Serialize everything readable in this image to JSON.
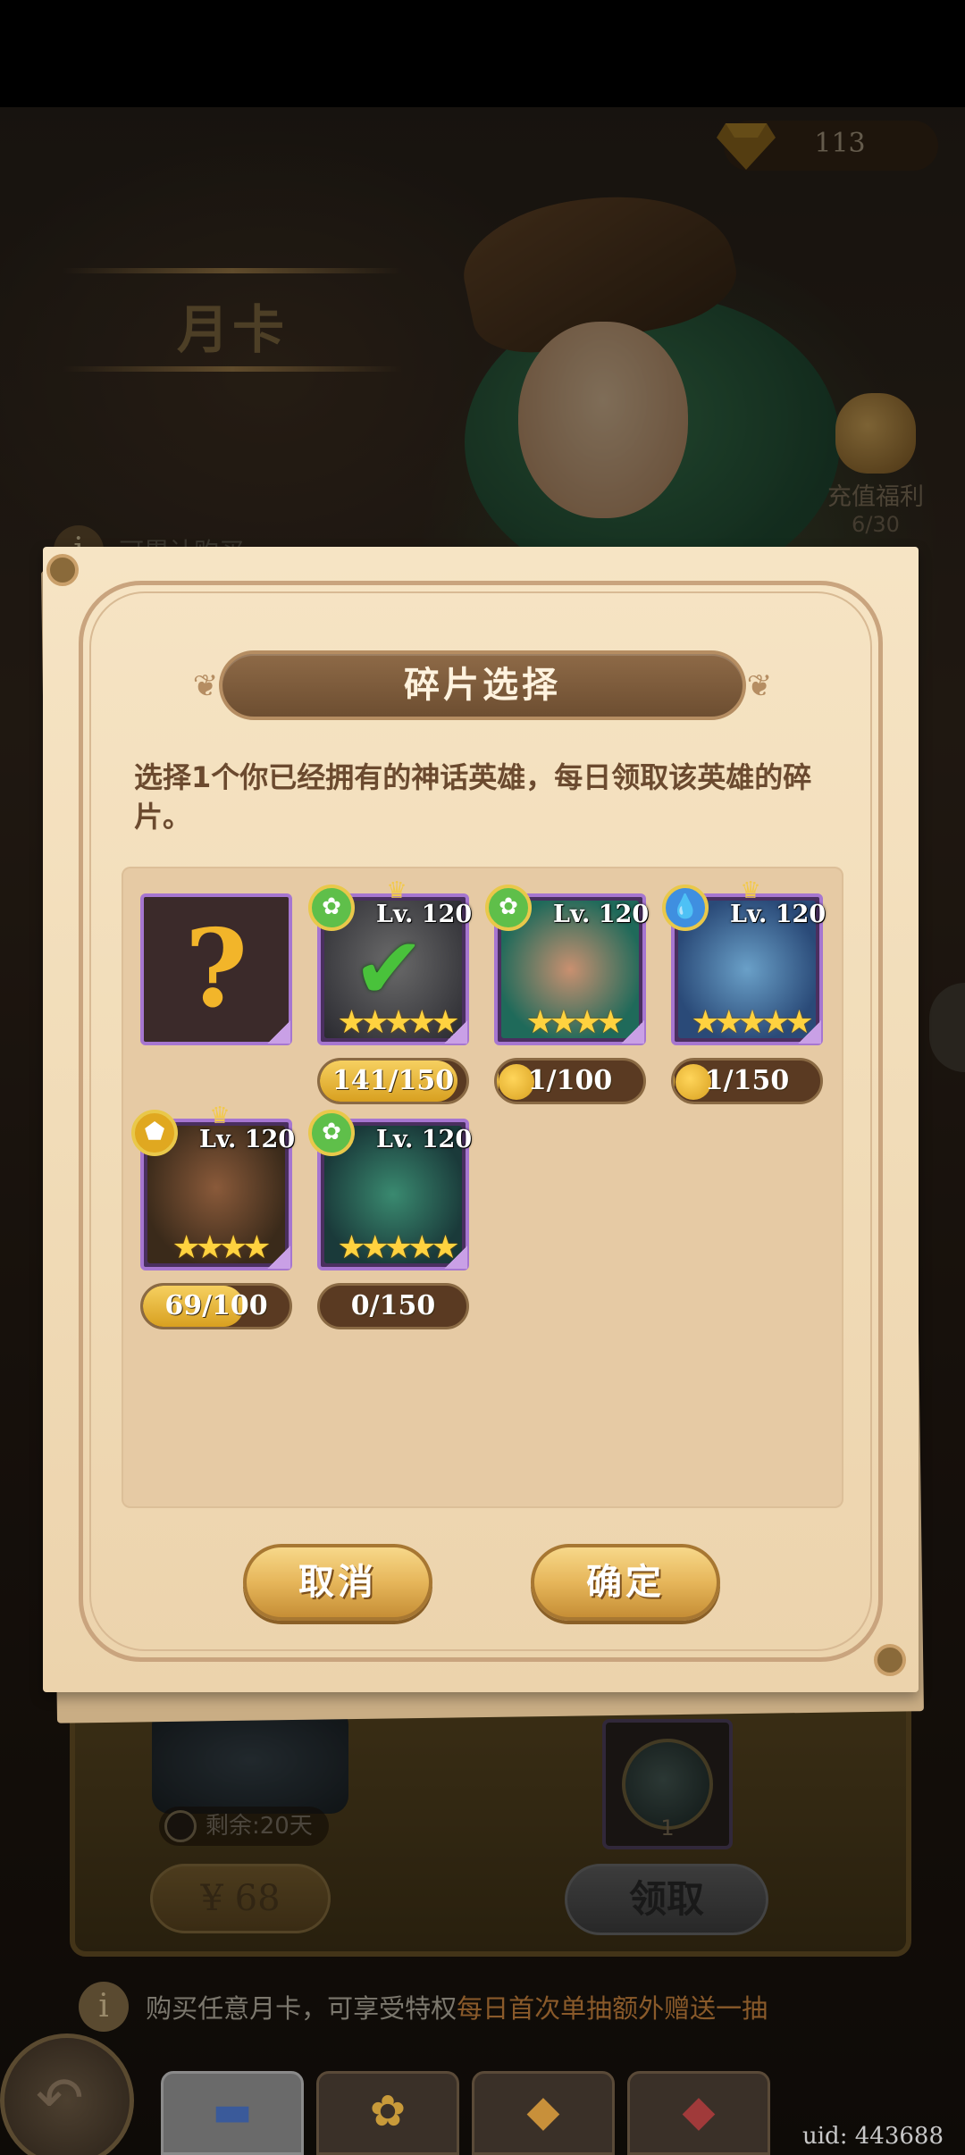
{
  "header": {
    "gems": "113"
  },
  "month_card": {
    "title": "月卡",
    "accumulate_note": "可累计购买"
  },
  "recharge": {
    "label": "充值福利",
    "count": "6/30"
  },
  "lower": {
    "remaining": "剩余:20天",
    "price": "¥ 68",
    "daily_item_count": "1",
    "claim_label": "领取"
  },
  "bottom_info": {
    "text_prefix": "购买任意月卡，可享受特权",
    "text_highlight": "每日首次单抽额外赠送一抽"
  },
  "uid": "uid: 443688",
  "modal": {
    "title": "碎片选择",
    "description": "选择1个你已经拥有的神话英雄，每日领取该英雄的碎片。",
    "cancel_label": "取消",
    "confirm_label": "确定",
    "heroes": [
      {
        "level": "",
        "progress": "",
        "unknown": true
      },
      {
        "level": "Lv. 120",
        "progress": "141/150",
        "fill": 0.94,
        "stars": "★★★★★",
        "element": "nature-icon",
        "selected": true,
        "element_color": "#5fbf4a"
      },
      {
        "level": "Lv. 120",
        "progress": "1/100",
        "fill": 0.01,
        "stars": "★★★★",
        "element": "nature-icon",
        "selected": false,
        "element_color": "#5fbf4a"
      },
      {
        "level": "Lv. 120",
        "progress": "1/150",
        "fill": 0.0067,
        "stars": "★★★★★",
        "element": "water-icon",
        "selected": false,
        "element_color": "#3f8fe0"
      },
      {
        "level": "Lv. 120",
        "progress": "69/100",
        "fill": 0.69,
        "stars": "★★★★",
        "element": "light-icon",
        "selected": false,
        "element_color": "#e0a820"
      },
      {
        "level": "Lv. 120",
        "progress": "0/150",
        "fill": 0,
        "stars": "★★★★★",
        "element": "nature-icon",
        "selected": false,
        "element_color": "#5fbf4a"
      }
    ]
  }
}
